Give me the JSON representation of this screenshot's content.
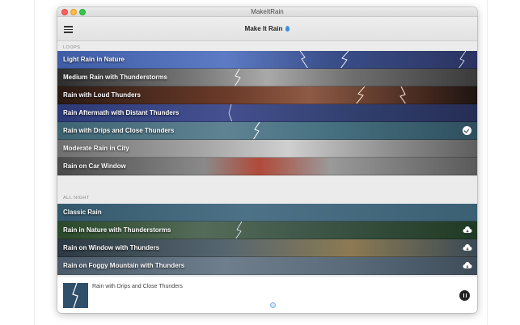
{
  "window": {
    "title": "MakeItRain"
  },
  "toolbar": {
    "menu_icon": "hamburger-icon",
    "app_title": "Make It Rain",
    "title_icon": "raindrop-icon"
  },
  "sections": {
    "loops": {
      "label": "LOOPS",
      "items": [
        {
          "label": "Light Rain in Nature"
        },
        {
          "label": "Medium Rain with Thunderstorms"
        },
        {
          "label": "Rain with Loud Thunders"
        },
        {
          "label": "Rain Aftermath with Distant Thunders"
        },
        {
          "label": "Rain with Drips and Close Thunders",
          "selected": true,
          "icon": "checkmark-icon"
        },
        {
          "label": "Moderate Rain in City"
        },
        {
          "label": "Rain on Car Window"
        }
      ]
    },
    "all_night": {
      "label": "ALL NIGHT",
      "items": [
        {
          "label": "Classic Rain"
        },
        {
          "label": "Rain in Nature with Thunderstorms",
          "icon": "cloud-download-icon"
        },
        {
          "label": "Rain on Window with Thunders",
          "icon": "cloud-download-icon"
        },
        {
          "label": "Rain on Foggy Mountain with Thunders",
          "icon": "cloud-download-icon"
        }
      ]
    }
  },
  "player": {
    "now_playing": "Rain with Drips and Close Thunders",
    "state_icon": "pause-icon"
  },
  "colors": {
    "accent": "#3b8fe0",
    "window_bg": "#ebebeb",
    "player_bg": "#ffffff"
  }
}
